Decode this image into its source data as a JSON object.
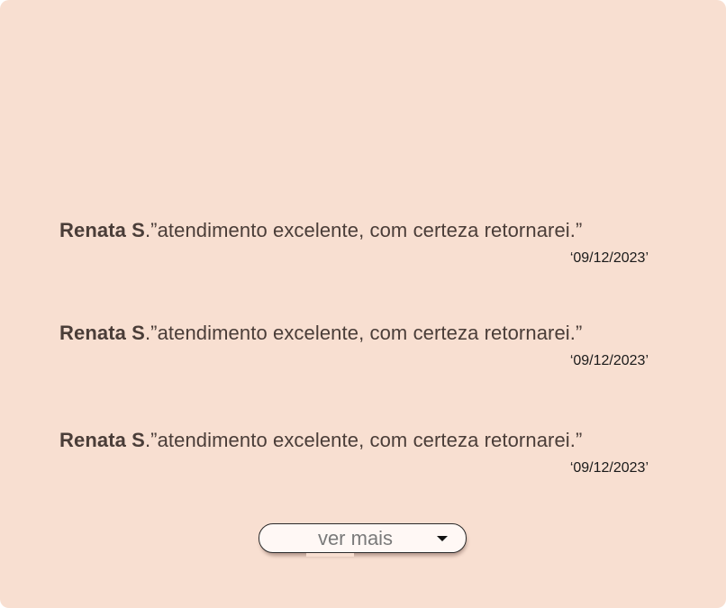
{
  "reviews": [
    {
      "author": "Renata S",
      "text": ".”atendimento excelente, com certeza retornarei.”",
      "date": "‘09/12/2023’"
    },
    {
      "author": "Renata S",
      "text": ".”atendimento excelente, com certeza retornarei.”",
      "date": "‘09/12/2023’"
    },
    {
      "author": "Renata S",
      "text": ".”atendimento excelente, com certeza retornarei.”",
      "date": "‘09/12/2023’"
    }
  ],
  "more_button": {
    "label": "ver mais",
    "icon": "caret-down-icon"
  },
  "colors": {
    "background": "#f8dfd1",
    "text": "#4a3d38",
    "button_bg": "#fff8f5"
  }
}
